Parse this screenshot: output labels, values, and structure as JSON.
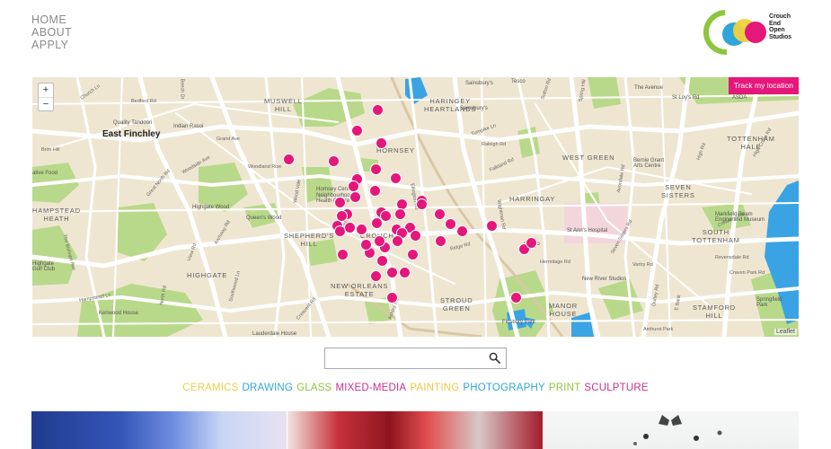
{
  "nav": {
    "items": [
      "HOME",
      "ABOUT",
      "APPLY"
    ]
  },
  "logo": {
    "line1": "Crouch End",
    "line2": "Open",
    "line3": "Studios"
  },
  "map": {
    "zoom_in": "+",
    "zoom_out": "−",
    "track_button": "Track my location",
    "attribution": "Leaflet",
    "areas": {
      "muswell_hill": "MUSWELL\nHILL",
      "haringey_heartlands": "HARINGEY\nHEARTLANDS",
      "hornsey": "HORNSEY",
      "west_green": "WEST GREEN",
      "tottenham_hale": "TOTTENHAM\nHALE",
      "east_finchley": "East Finchley",
      "harringay": "HARRINGAY",
      "seven_sisters": "SEVEN\nSISTERS",
      "hampstead_heath": "HAMPSTEAD\nHEATH",
      "shepherds_hill": "SHEPHERD'S\nHILL",
      "crouch_end": "CROUCH",
      "south_tottenham": "SOUTH\nTOTTENHAM",
      "highgate": "HIGHGATE",
      "new_orleans_estate": "NEW ORLEANS\nESTATE",
      "stroud_green": "STROUD\nGREEN",
      "manor_house": "MANOR\nHOUSE",
      "stamford_hill": "STAMFORD\nHILL"
    },
    "places": {
      "quality_tandoori": "Quality Tandoori",
      "indian_rasoi": "Indian Rasoi",
      "highgate_wood": "Highgate Wood",
      "queens_wood": "Queen's Wood",
      "highgate_golf_club": "Highgate\nGolf Club",
      "kenwood_house": "Kenwood House",
      "lauderdale_house": "Lauderdale House",
      "hornsey_central": "Hornsey Central\nNeighbourhood\nHealth Centre",
      "bernie_grant": "Bernie Grant\nArts Centre",
      "st_anns": "St Ann's Hospital",
      "mezzo": "mezzo",
      "new_river_studios": "New River Studios",
      "finsbury_park": "Finsbury Park",
      "springfield_park": "Springfield\nPark",
      "sainsburys_1": "Sainsbury's",
      "sainsburys_2": "Sainsbury's",
      "tesco": "Tesco",
      "asda": "ASDA",
      "the_avenue": "The Avenue",
      "st_loys": "St Loy's Rd",
      "active_food": "ative Food",
      "hampstead_golf": "Hampstead\nGolf Club",
      "engine_house": "Markfield Beam\nEngine and Museum"
    },
    "roads": {
      "church_ln": "Church Ln",
      "bedford_rd": "Bedford Rd",
      "beech_dr": "Beech Dr",
      "grand_ave": "Grand Ave",
      "woodside_ave": "Woodside Ave",
      "woodland_rise": "Woodland Rise",
      "great_north_rd": "Great North Rd",
      "brim_hill": "Brim Hill",
      "archway_rd": "Archway Rd",
      "wood_vale": "Wood Vale",
      "priory_rd": "Priory Rd",
      "turnpike_ln": "Turnpike Ln",
      "falkland_rd": "Falkland Rd",
      "raleigh_rd": "Raleigh Rd",
      "crowland_rd": "Crowland Rd",
      "vartry_rd": "Vartry Rd",
      "ridge_rd": "Ridge Rd",
      "hermitage_rd": "Hermitage Rd",
      "hampstead_ln": "Hampstead Ln",
      "view_rd": "View Rd",
      "southwood_ln": "Southwood Ln",
      "north_rd": "North Rd",
      "craven_park_rd": "Craven Park Rd",
      "revensdale_rd": "Revensdale Rd",
      "amhurst_park": "Amhurst Park",
      "high_rd": "High Rd",
      "ashley_rd": "Ashley Rd",
      "wightman_rd": "Wightman Rd",
      "the_bishops_ave": "The Bishops Ave",
      "sutton_rd": "Sutton Rd",
      "high_cross_rd": "High Cross Rd",
      "seven_sisters_rd": "Seven Sisters Rd",
      "avondale_rd": "Avondale Rd",
      "tottenham_rd": "Tottenham Rd",
      "e_bank": "E Bank",
      "spring_hill": "Spring Hill",
      "dunloe_rd": "Durley Rd",
      "crescent_rd": "Crescent Rd",
      "ellington_rd": "Ellington Rd"
    },
    "markers": [
      {
        "lat": 0.128,
        "lng": 0.451
      },
      {
        "lat": 0.205,
        "lng": 0.424
      },
      {
        "lat": 0.253,
        "lng": 0.456
      },
      {
        "lat": 0.318,
        "lng": 0.335
      },
      {
        "lat": 0.325,
        "lng": 0.393
      },
      {
        "lat": 0.353,
        "lng": 0.449
      },
      {
        "lat": 0.391,
        "lng": 0.474
      },
      {
        "lat": 0.394,
        "lng": 0.424
      },
      {
        "lat": 0.422,
        "lng": 0.419
      },
      {
        "lat": 0.436,
        "lng": 0.447
      },
      {
        "lat": 0.463,
        "lng": 0.422
      },
      {
        "lat": 0.477,
        "lng": 0.508
      },
      {
        "lat": 0.484,
        "lng": 0.402
      },
      {
        "lat": 0.491,
        "lng": 0.483
      },
      {
        "lat": 0.491,
        "lng": 0.508
      },
      {
        "lat": 0.522,
        "lng": 0.456
      },
      {
        "lat": 0.529,
        "lng": 0.411
      },
      {
        "lat": 0.529,
        "lng": 0.48
      },
      {
        "lat": 0.536,
        "lng": 0.461
      },
      {
        "lat": 0.529,
        "lng": 0.532
      },
      {
        "lat": 0.567,
        "lng": 0.546
      },
      {
        "lat": 0.536,
        "lng": 0.404
      },
      {
        "lat": 0.564,
        "lng": 0.45
      },
      {
        "lat": 0.574,
        "lng": 0.398
      },
      {
        "lat": 0.581,
        "lng": 0.493
      },
      {
        "lat": 0.588,
        "lng": 0.475
      },
      {
        "lat": 0.588,
        "lng": 0.43
      },
      {
        "lat": 0.595,
        "lng": 0.561
      },
      {
        "lat": 0.571,
        "lng": 0.6
      },
      {
        "lat": 0.595,
        "lng": 0.401
      },
      {
        "lat": 0.581,
        "lng": 0.414
      },
      {
        "lat": 0.602,
        "lng": 0.483
      },
      {
        "lat": 0.609,
        "lng": 0.5
      },
      {
        "lat": 0.63,
        "lng": 0.477
      },
      {
        "lat": 0.63,
        "lng": 0.533
      },
      {
        "lat": 0.654,
        "lng": 0.46
      },
      {
        "lat": 0.678,
        "lng": 0.44
      },
      {
        "lat": 0.644,
        "lng": 0.436
      },
      {
        "lat": 0.63,
        "lng": 0.453
      },
      {
        "lat": 0.682,
        "lng": 0.497
      },
      {
        "lat": 0.661,
        "lng": 0.642
      },
      {
        "lat": 0.64,
        "lng": 0.651
      },
      {
        "lat": 0.685,
        "lng": 0.405
      },
      {
        "lat": 0.709,
        "lng": 0.457
      },
      {
        "lat": 0.754,
        "lng": 0.47
      },
      {
        "lat": 0.754,
        "lng": 0.486
      },
      {
        "lat": 0.768,
        "lng": 0.448
      },
      {
        "lat": 0.851,
        "lng": 0.631
      },
      {
        "lat": 0.851,
        "lng": 0.469
      }
    ]
  },
  "search": {
    "placeholder": "",
    "value": ""
  },
  "categories": [
    {
      "label": "CERAMICS",
      "color": "#e8d04a"
    },
    {
      "label": "DRAWING",
      "color": "#2fa6d9"
    },
    {
      "label": "GLASS",
      "color": "#8dc63f"
    },
    {
      "label": "MIXED-MEDIA",
      "color": "#cc2f8e"
    },
    {
      "label": "PAINTING",
      "color": "#f2c744"
    },
    {
      "label": "PHOTOGRAPHY",
      "color": "#2fa6d9"
    },
    {
      "label": "PRINT",
      "color": "#8dc63f"
    },
    {
      "label": "SCULPTURE",
      "color": "#cc2f8e"
    }
  ],
  "colors": {
    "accent": "#e5177b",
    "park": "#b9d98a",
    "water": "#3aa3e3",
    "land": "#efe6d2",
    "road": "#ffffff"
  }
}
